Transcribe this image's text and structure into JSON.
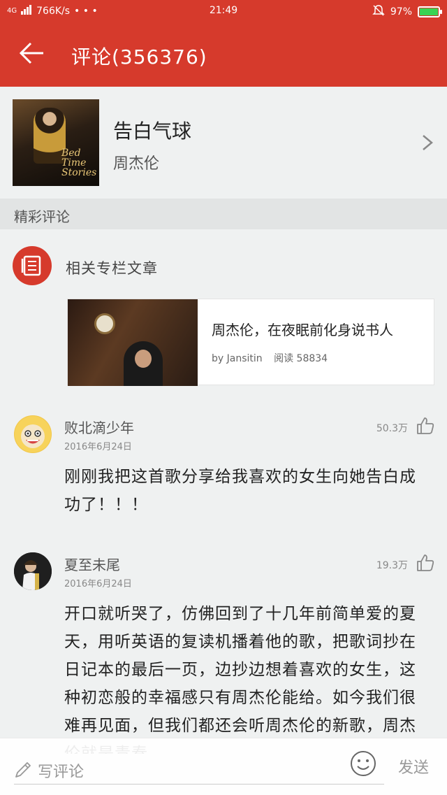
{
  "status_bar": {
    "network": "4G",
    "speed": "766K/s",
    "dots": "• • •",
    "time": "21:49",
    "battery": "97%"
  },
  "header": {
    "title": "评论(356376)"
  },
  "song": {
    "title": "告白气球",
    "artist": "周杰伦",
    "cover_text": "Bed Time Stories"
  },
  "section": {
    "title": "精彩评论"
  },
  "related": {
    "label": "相关专栏文章",
    "article": {
      "title": "周杰伦，在夜眠前化身说书人",
      "author": "by Jansitin",
      "reads": "阅读 58834"
    }
  },
  "comments": [
    {
      "user": "败北滴少年",
      "date": "2016年6月24日",
      "likes": "50.3万",
      "text": "刚刚我把这首歌分享给我喜欢的女生向她告白成功了！！！"
    },
    {
      "user": "夏至未尾",
      "date": "2016年6月24日",
      "likes": "19.3万",
      "text": "开口就听哭了，仿佛回到了十几年前简单爱的夏天，用听英语的复读机播着他的歌，把歌词抄在日记本的最后一页，边抄边想着喜欢的女生，这种初恋般的幸福感只有周杰伦能给。如今我们很难再见面，但我们都还会听周杰伦的新歌，周杰伦就是青春，"
    }
  ],
  "bottom_bar": {
    "placeholder": "写评论",
    "send": "发送"
  },
  "colors": {
    "brand_red": "#d63a2c",
    "background": "#eff1f1"
  }
}
